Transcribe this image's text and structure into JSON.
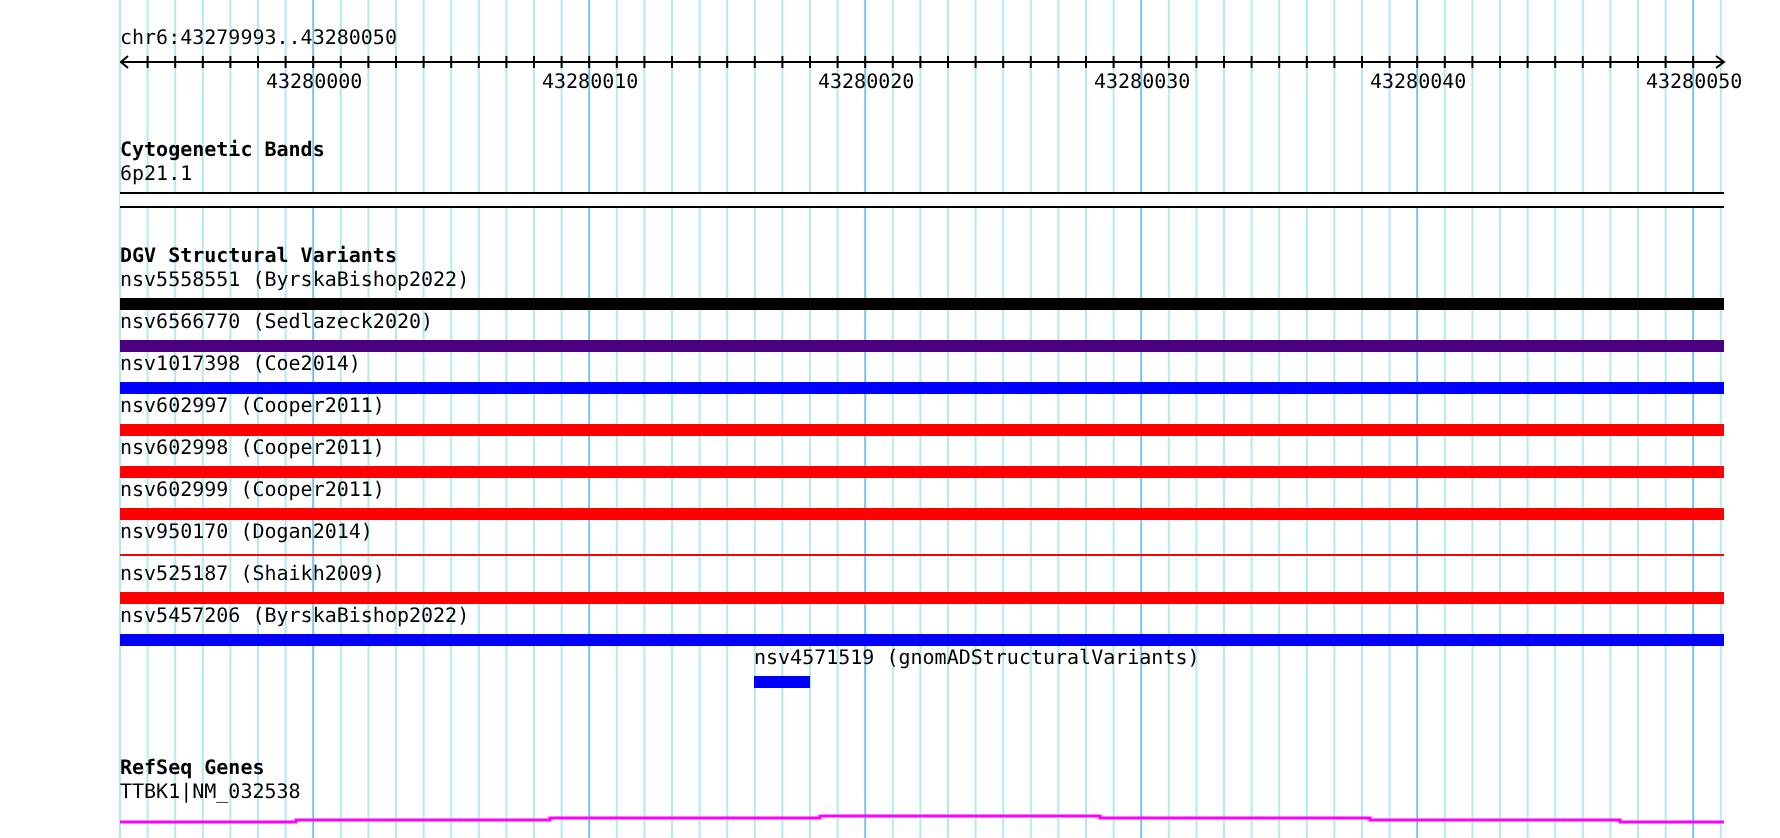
{
  "ruler": {
    "range": "chr6:43279993..43280050",
    "tick_labels": [
      "43280000",
      "43280010",
      "43280020",
      "43280030",
      "43280040",
      "43280050"
    ]
  },
  "tracks": [
    {
      "title": "Cytogenetic Bands",
      "features": [
        {
          "kind": "band",
          "label": "6p21.1"
        }
      ]
    },
    {
      "title": "DGV Structural Variants",
      "features": [
        {
          "kind": "bar",
          "label": "nsv5558551 (ByrskaBishop2022)",
          "color": "#000000"
        },
        {
          "kind": "bar",
          "label": "nsv6566770 (Sedlazeck2020)",
          "color": "#4b0082"
        },
        {
          "kind": "bar",
          "label": "nsv1017398 (Coe2014)",
          "color": "#0000ff"
        },
        {
          "kind": "bar",
          "label": "nsv602997 (Cooper2011)",
          "color": "#ff0000"
        },
        {
          "kind": "bar",
          "label": "nsv602998 (Cooper2011)",
          "color": "#ff0000"
        },
        {
          "kind": "bar",
          "label": "nsv602999 (Cooper2011)",
          "color": "#ff0000"
        },
        {
          "kind": "line",
          "label": "nsv950170 (Dogan2014)",
          "color": "#ff0000"
        },
        {
          "kind": "bar",
          "label": "nsv525187 (Shaikh2009)",
          "color": "#ff0000"
        },
        {
          "kind": "bar",
          "label": "nsv5457206 (ByrskaBishop2022)",
          "color": "#0000ff"
        },
        {
          "kind": "short",
          "label": "nsv4571519 (gnomADStructuralVariants)",
          "color": "#0000ff"
        }
      ]
    },
    {
      "title": "RefSeq Genes",
      "features": [
        {
          "kind": "gene",
          "label": "TTBK1|NM_032538",
          "color": "#ff00ff"
        }
      ]
    }
  ]
}
